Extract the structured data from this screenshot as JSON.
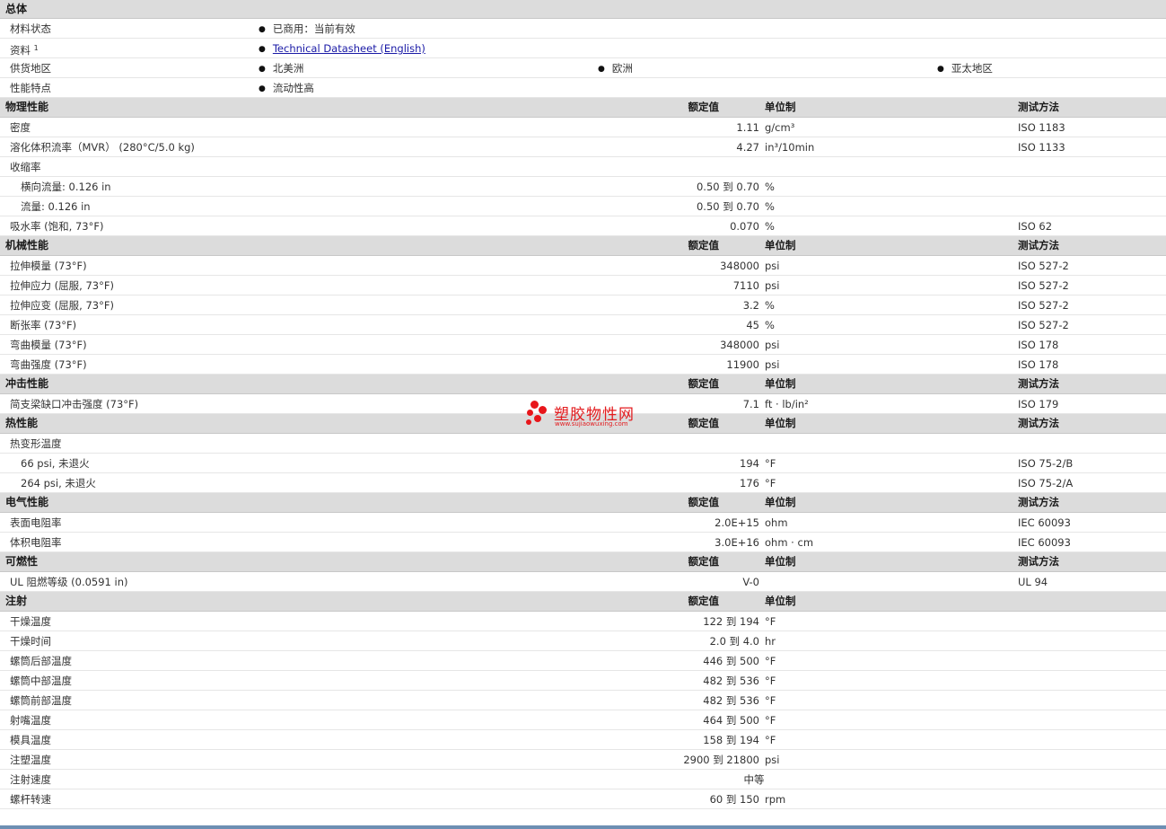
{
  "general": {
    "title": "总体",
    "rows": [
      {
        "label": "材料状态",
        "items": [
          "已商用：当前有效"
        ]
      },
      {
        "label": "资料",
        "sup": "1",
        "items": [
          "Technical Datasheet (English)"
        ],
        "link": true
      },
      {
        "label": "供货地区",
        "items": [
          "北美洲",
          "欧洲",
          "亚太地区"
        ]
      },
      {
        "label": "性能特点",
        "items": [
          "流动性高"
        ]
      }
    ]
  },
  "headers": {
    "value": "额定值",
    "unit": "单位制",
    "test": "测试方法"
  },
  "sections": [
    {
      "title": "物理性能",
      "show_test": true,
      "rows": [
        {
          "label": "密度",
          "value": "1.11",
          "unit": "g/cm³",
          "test": "ISO 1183"
        },
        {
          "label": "溶化体积流率（MVR） (280°C/5.0 kg)",
          "value": "4.27",
          "unit": "in³/10min",
          "test": "ISO 1133"
        },
        {
          "label": "收缩率",
          "value": "",
          "unit": "",
          "test": ""
        },
        {
          "label": "横向流量: 0.126 in",
          "sub": true,
          "value": "0.50 到  0.70",
          "unit": "%",
          "test": ""
        },
        {
          "label": "流量: 0.126 in",
          "sub": true,
          "value": "0.50 到  0.70",
          "unit": "%",
          "test": ""
        },
        {
          "label": "吸水率 (饱和, 73°F)",
          "value": "0.070",
          "unit": "%",
          "test": "ISO 62"
        }
      ]
    },
    {
      "title": "机械性能",
      "show_test": true,
      "rows": [
        {
          "label": "拉伸模量 (73°F)",
          "value": "348000",
          "unit": "psi",
          "test": "ISO 527-2"
        },
        {
          "label": "拉伸应力 (屈服, 73°F)",
          "value": "7110",
          "unit": "psi",
          "test": "ISO 527-2"
        },
        {
          "label": "拉伸应变 (屈服, 73°F)",
          "value": "3.2",
          "unit": "%",
          "test": "ISO 527-2"
        },
        {
          "label": "断张率 (73°F)",
          "value": "45",
          "unit": "%",
          "test": "ISO 527-2"
        },
        {
          "label": "弯曲模量 (73°F)",
          "value": "348000",
          "unit": "psi",
          "test": "ISO 178"
        },
        {
          "label": "弯曲强度 (73°F)",
          "value": "11900",
          "unit": "psi",
          "test": "ISO 178"
        }
      ]
    },
    {
      "title": "冲击性能",
      "show_test": true,
      "rows": [
        {
          "label": "简支梁缺口冲击强度 (73°F)",
          "value": "7.1",
          "unit": "ft · lb/in²",
          "test": "ISO 179"
        }
      ]
    },
    {
      "title": "热性能",
      "show_test": true,
      "rows": [
        {
          "label": "热变形温度",
          "value": "",
          "unit": "",
          "test": ""
        },
        {
          "label": "66 psi, 未退火",
          "sub": true,
          "value": "194",
          "unit": "°F",
          "test": "ISO 75-2/B"
        },
        {
          "label": "264 psi, 未退火",
          "sub": true,
          "value": "176",
          "unit": "°F",
          "test": "ISO 75-2/A"
        }
      ]
    },
    {
      "title": "电气性能",
      "show_test": true,
      "rows": [
        {
          "label": "表面电阻率",
          "value": "2.0E+15",
          "unit": "ohm",
          "test": "IEC 60093"
        },
        {
          "label": "体积电阻率",
          "value": "3.0E+16",
          "unit": "ohm · cm",
          "test": "IEC 60093"
        }
      ]
    },
    {
      "title": "可燃性",
      "show_test": true,
      "rows": [
        {
          "label": "UL 阻燃等级 (0.0591 in)",
          "value": "V-0",
          "unit": "",
          "test": "UL 94"
        }
      ]
    },
    {
      "title": "注射",
      "show_test": false,
      "rows": [
        {
          "label": "干燥温度",
          "value": "122 到  194",
          "unit": "°F",
          "test": ""
        },
        {
          "label": "干燥时间",
          "value": "2.0 到  4.0",
          "unit": "hr",
          "test": ""
        },
        {
          "label": "螺筒后部温度",
          "value": "446 到  500",
          "unit": "°F",
          "test": ""
        },
        {
          "label": "螺筒中部温度",
          "value": "482 到  536",
          "unit": "°F",
          "test": ""
        },
        {
          "label": "螺筒前部温度",
          "value": "482 到  536",
          "unit": "°F",
          "test": ""
        },
        {
          "label": "射嘴温度",
          "value": "464 到  500",
          "unit": "°F",
          "test": ""
        },
        {
          "label": "模具温度",
          "value": "158 到  194",
          "unit": "°F",
          "test": ""
        },
        {
          "label": "注塑温度",
          "value": "2900 到  21800",
          "unit": "psi",
          "test": ""
        },
        {
          "label": "注射速度",
          "value": "中等",
          "center": true,
          "unit": "",
          "test": ""
        },
        {
          "label": "螺杆转速",
          "value": "60 到  150",
          "unit": "rpm",
          "test": ""
        }
      ]
    }
  ],
  "watermark": {
    "text": "塑胶物性网",
    "sub": "www.sujiaowuxing.com"
  }
}
